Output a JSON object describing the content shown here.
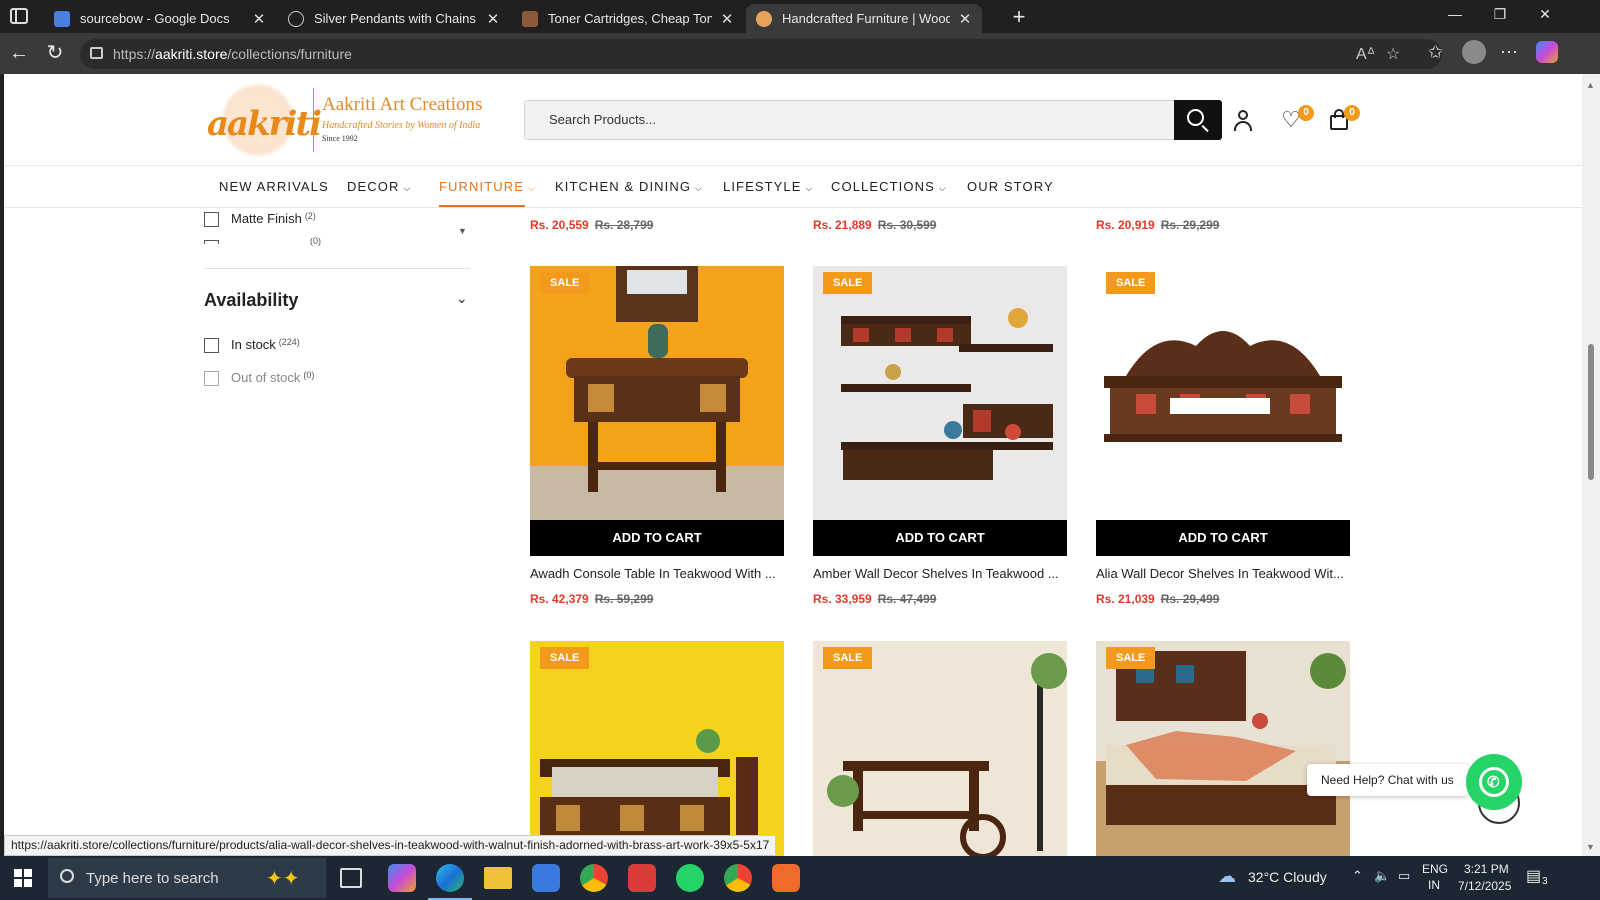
{
  "browser": {
    "tabs": [
      {
        "title": "sourcebow - Google Docs",
        "favicon_color": "#4a7ee0"
      },
      {
        "title": "Silver Pendants with Chains Archi",
        "favicon_color": "#666666"
      },
      {
        "title": "Toner Cartridges, Cheap Toner Ca",
        "favicon_color": "#8a5a3a"
      },
      {
        "title": "Handcrafted Furniture | Wooden (",
        "favicon_color": "#e8a45a"
      }
    ],
    "url_prefix": "https://",
    "url_domain": "aakriti.store",
    "url_path": "/collections/furniture"
  },
  "header": {
    "logo_word": "aakriti",
    "brand_name": "Aakriti Art Creations",
    "tagline": "Handcrafted Stories by Women of India",
    "since": "Since 1992",
    "search_placeholder": "Search Products...",
    "wishlist_count": "0",
    "cart_count": "0"
  },
  "menu": [
    {
      "label": "NEW ARRIVALS",
      "chevron": ""
    },
    {
      "label": "DECOR",
      "chevron": "⌵"
    },
    {
      "label": "FURNITURE",
      "chevron": "⌵"
    },
    {
      "label": "KITCHEN & DINING",
      "chevron": "⌵"
    },
    {
      "label": "LIFESTYLE",
      "chevron": "⌵"
    },
    {
      "label": "COLLECTIONS",
      "chevron": "⌵"
    },
    {
      "label": "OUR STORY",
      "chevron": ""
    }
  ],
  "filters": {
    "finish_option": {
      "label": "Matte Finish",
      "count": "(2)"
    },
    "hidden_count": "(0)",
    "availability_title": "Availability",
    "in_stock": {
      "label": "In stock",
      "count": "(224)"
    },
    "out_of_stock": {
      "label": "Out of stock",
      "count": "(0)"
    }
  },
  "top_prices": [
    {
      "now": "Rs. 20,559",
      "old": "Rs. 28,799"
    },
    {
      "now": "Rs. 21,889",
      "old": "Rs. 30,599"
    },
    {
      "now": "Rs. 20,919",
      "old": "Rs. 29,299"
    }
  ],
  "products": [
    {
      "name": "Awadh Console Table In Teakwood With ...",
      "now": "Rs. 42,379",
      "old": "Rs. 59,299",
      "badge": "SALE",
      "cta": "ADD TO CART"
    },
    {
      "name": "Amber Wall Decor Shelves In Teakwood ...",
      "now": "Rs. 33,959",
      "old": "Rs. 47,499",
      "badge": "SALE",
      "cta": "ADD TO CART"
    },
    {
      "name": "Alia Wall Decor Shelves In Teakwood Wit...",
      "now": "Rs. 21,039",
      "old": "Rs. 29,499",
      "badge": "SALE",
      "cta": "ADD TO CART"
    },
    {
      "badge": "SALE"
    },
    {
      "badge": "SALE"
    },
    {
      "badge": "SALE"
    }
  ],
  "chat": {
    "label": "Need Help? Chat with us"
  },
  "status_url": "https://aakriti.store/collections/furniture/products/alia-wall-decor-shelves-in-teakwood-with-walnut-finish-adorned-with-brass-art-work-39x5-5x17",
  "taskbar": {
    "search_placeholder": "Type here to search",
    "weather": "32°C  Cloudy",
    "lang1": "ENG",
    "lang2": "IN",
    "time": "3:21 PM",
    "date": "7/12/2025",
    "notif_count": "3"
  },
  "colors": {
    "accent": "#e6741c",
    "sale": "#f39a1c",
    "price": "#e03a2a",
    "whatsapp": "#25d366"
  }
}
